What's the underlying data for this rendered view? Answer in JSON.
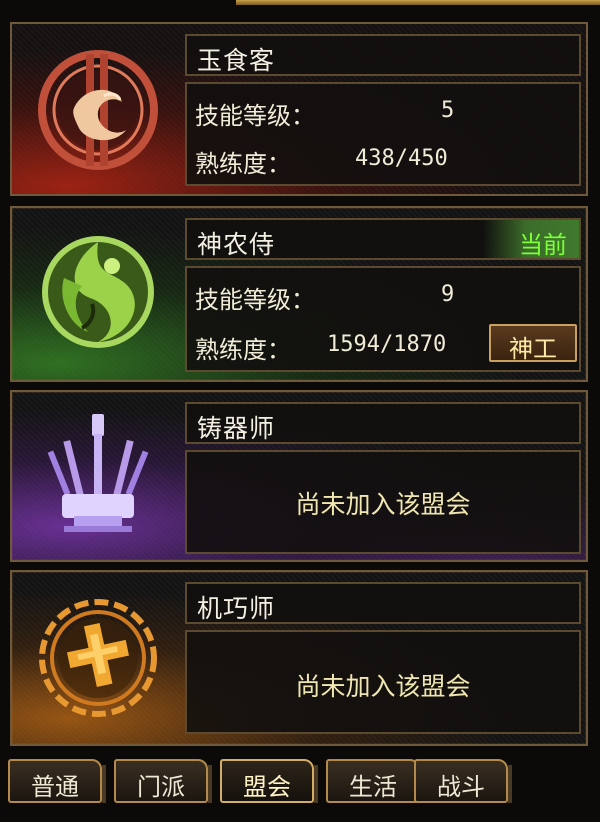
{
  "skills": [
    {
      "name": "玉食客",
      "level_label": "技能等级：",
      "level": "5",
      "proficiency_label": "熟练度：",
      "proficiency": "438/450"
    },
    {
      "name": "神农侍",
      "badge": "当前",
      "level_label": "技能等级：",
      "level": "9",
      "proficiency_label": "熟练度：",
      "proficiency": "1594/1870",
      "action_label": "神工"
    },
    {
      "name": "铸器师",
      "message": "尚未加入该盟会"
    },
    {
      "name": "机巧师",
      "message": "尚未加入该盟会"
    }
  ],
  "tabs": [
    {
      "label": "普通"
    },
    {
      "label": "门派"
    },
    {
      "label": "盟会",
      "active": true
    },
    {
      "label": "生活"
    },
    {
      "label": "战斗"
    }
  ],
  "colors": {
    "panel_border": "#6e5a3a",
    "current_badge": "#7dff3a",
    "tab_border": "#b48a4c"
  },
  "icons": [
    "fish-emblem-icon",
    "herb-emblem-icon",
    "forge-emblem-icon",
    "gear-emblem-icon"
  ]
}
